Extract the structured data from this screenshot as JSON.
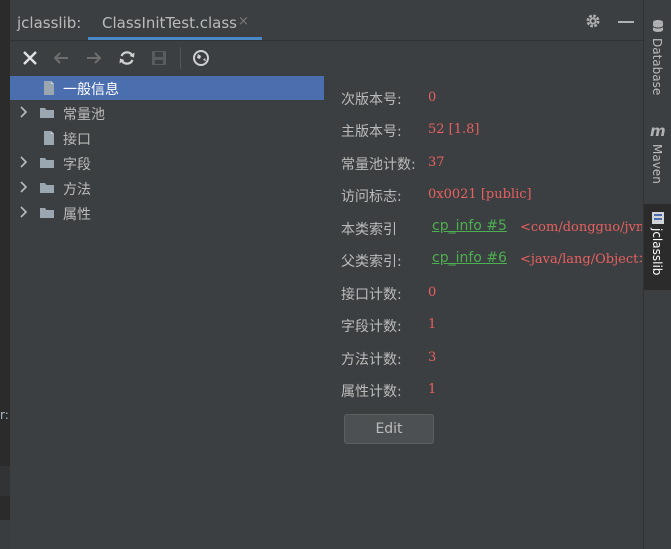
{
  "header": {
    "title": "jclasslib:",
    "tab_label": "ClassInitTest.class",
    "tab_close": "×"
  },
  "toolbar": {
    "buttons": [
      "close-icon",
      "back-icon",
      "forward-icon",
      "refresh-icon",
      "save-icon",
      "web-icon"
    ]
  },
  "tree": {
    "items": [
      {
        "label": "一般信息",
        "expandable": false,
        "selected": true,
        "icon": "file-icon"
      },
      {
        "label": "常量池",
        "expandable": true,
        "selected": false,
        "icon": "folder-icon"
      },
      {
        "label": "接口",
        "expandable": false,
        "selected": false,
        "icon": "file-icon"
      },
      {
        "label": "字段",
        "expandable": true,
        "selected": false,
        "icon": "folder-icon"
      },
      {
        "label": "方法",
        "expandable": true,
        "selected": false,
        "icon": "folder-icon"
      },
      {
        "label": "属性",
        "expandable": true,
        "selected": false,
        "icon": "folder-icon"
      }
    ]
  },
  "details": {
    "minor_version": {
      "label": "次版本号:",
      "value": "0"
    },
    "major_version": {
      "label": "主版本号:",
      "value": "52 [1.8]"
    },
    "constant_pool_count": {
      "label": "常量池计数:",
      "value": "37"
    },
    "access_flags": {
      "label": "访问标志:",
      "value": "0x0021 [public]"
    },
    "this_class": {
      "label": "本类索引",
      "link": "cp_info #5",
      "ref": "<com/dongguo/jvm"
    },
    "super_class": {
      "label": "父类索引:",
      "link": "cp_info #6",
      "ref": "<java/lang/Object>"
    },
    "interfaces_count": {
      "label": "接口计数:",
      "value": "0"
    },
    "fields_count": {
      "label": "字段计数:",
      "value": "1"
    },
    "methods_count": {
      "label": "方法计数:",
      "value": "3"
    },
    "attributes_count": {
      "label": "属性计数:",
      "value": "1"
    },
    "edit_label": "Edit"
  },
  "rightbar": {
    "items": [
      {
        "label": "Database",
        "icon": "database-icon"
      },
      {
        "label": "Maven",
        "icon": "maven-icon"
      },
      {
        "label": "jclasslib",
        "icon": "jclasslib-icon",
        "active": true
      }
    ]
  },
  "editor_edge_glyph": "r:",
  "colors": {
    "background": "#3c3f41",
    "selection": "#4b6eaf",
    "value_red": "#e86060",
    "link_green": "#4caf50",
    "tab_accent": "#4a88c7"
  }
}
